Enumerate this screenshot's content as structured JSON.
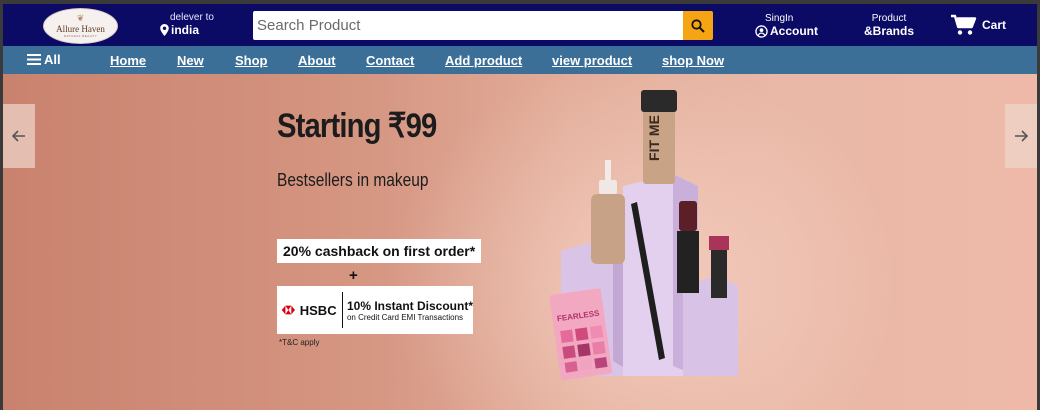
{
  "header": {
    "logo": {
      "name": "Allure Haven",
      "tagline": "NATURAL BEAUTY"
    },
    "deliver": {
      "label": "delever to",
      "location": "india"
    },
    "search": {
      "placeholder": "Search Product"
    },
    "account": {
      "line1": "SingIn",
      "line2": "Account"
    },
    "brands": {
      "line1": "Product",
      "line2": "&Brands"
    },
    "cart": {
      "label": "Cart"
    },
    "colors": {
      "header_bg": "#0b0b66",
      "search_button": "#f5a513"
    }
  },
  "nav": {
    "all_label": "All",
    "links": [
      "Home",
      "New",
      "Shop",
      "About",
      "Contact",
      "Add product",
      "view product",
      "shop Now"
    ],
    "color": "#3b6f98"
  },
  "hero": {
    "headline": "Starting ₹99",
    "subheadline": "Bestsellers in makeup",
    "offer1": "20% cashback on first order*",
    "plus": "+",
    "bank": "HSBC",
    "offer2_title": "10% Instant Discount*",
    "offer2_sub": "on Credit Card EMI Transactions",
    "tnc": "*T&C apply",
    "foundation_label": "FIT ME",
    "palette_label": "FEARLESS"
  },
  "icons": [
    "map-pin-icon",
    "search-icon",
    "user-icon",
    "cart-icon",
    "menu-icon",
    "arrow-left-icon",
    "arrow-right-icon"
  ]
}
